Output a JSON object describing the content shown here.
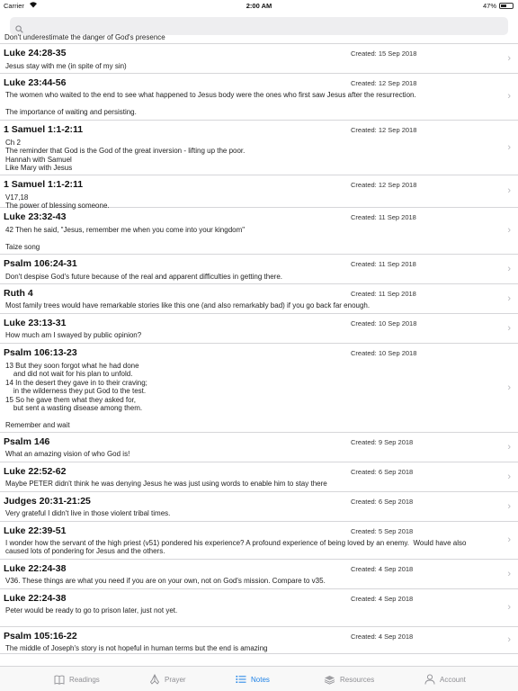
{
  "status": {
    "carrier": "Carrier",
    "time": "2:00 AM",
    "battery": "47%",
    "battery_level": 0.47
  },
  "search": {
    "placeholder": ""
  },
  "clipped_text": "Don't underestimate the danger of God's presence",
  "notes": [
    {
      "title": "Luke 24:28-35",
      "created": "Created: 15 Sep 2018",
      "body": "Jesus stay with me (in spite of my sin)"
    },
    {
      "title": "Luke 23:44-56",
      "created": "Created: 12 Sep 2018",
      "body": "The women who waited to the end to see what happened to Jesus body were the ones who first saw Jesus after the resurrection.\n\nThe importance of waiting and persisting."
    },
    {
      "title": "1 Samuel 1:1-2:11",
      "created": "Created: 12 Sep 2018",
      "body": "Ch 2\nThe reminder that God is the God of the great inversion - lifting up the poor.\nHannah with Samuel\nLike Mary with Jesus"
    },
    {
      "title": "1 Samuel 1:1-2:11",
      "created": "Created: 12 Sep 2018",
      "body": "V17,18\nThe power of blessing someone."
    },
    {
      "title": "Luke 23:32-43",
      "created": "Created: 11 Sep 2018",
      "body": "42 Then he said, \"Jesus, remember me when you come into your kingdom\"\n\nTaize song"
    },
    {
      "title": "Psalm 106:24-31",
      "created": "Created: 11 Sep 2018",
      "body": "Don't despise God's future because of the real and apparent difficulties in getting there."
    },
    {
      "title": "Ruth 4",
      "created": "Created: 11 Sep 2018",
      "body": "Most family trees would have remarkable stories like this one (and also remarkably bad) if you go back far enough."
    },
    {
      "title": "Luke 23:13-31",
      "created": "Created: 10 Sep 2018",
      "body": "How much am I swayed by public opinion?"
    },
    {
      "title": "Psalm 106:13-23",
      "created": "Created: 10 Sep 2018",
      "body": "13 But they soon forgot what he had done\n    and did not wait for his plan to unfold.\n14 In the desert they gave in to their craving;\n    in the wilderness they put God to the test.\n15 So he gave them what they asked for,\n    but sent a wasting disease among them.\n\nRemember and wait"
    },
    {
      "title": "Psalm 146",
      "created": "Created: 9 Sep 2018",
      "body": "What an amazing vision of who God is!"
    },
    {
      "title": "Luke 22:52-62",
      "created": "Created: 6 Sep 2018",
      "body": "Maybe PETER didn't think he was denying Jesus he was just using words to enable him to stay there"
    },
    {
      "title": "Judges 20:31-21:25",
      "created": "Created: 6 Sep 2018",
      "body": "Very grateful I didn't live in those violent tribal times."
    },
    {
      "title": "Luke 22:39-51",
      "created": "Created: 5 Sep 2018",
      "body": "I wonder how the servant of the high priest (v51) pondered his experience? A profound experience of being loved by an enemy.  Would have also\ncaused lots of pondering for Jesus and the others."
    },
    {
      "title": "Luke 22:24-38",
      "created": "Created: 4 Sep 2018",
      "body": "V36. These things are what you need if you are on your own, not on God's mission. Compare to v35."
    },
    {
      "title": "Luke 22:24-38",
      "created": "Created: 4 Sep 2018",
      "body": "Peter would be ready to go to prison later, just not yet."
    },
    {
      "title": "Psalm 105:16-22",
      "created": "Created: 4 Sep 2018",
      "body": "The middle of Joseph's story is not hopeful in human terms but the end is amazing"
    }
  ],
  "tabs": [
    {
      "label": "Readings",
      "icon": "book-icon",
      "active": false
    },
    {
      "label": "Prayer",
      "icon": "praying-hands-icon",
      "active": false
    },
    {
      "label": "Notes",
      "icon": "list-icon",
      "active": true
    },
    {
      "label": "Resources",
      "icon": "stack-icon",
      "active": false
    },
    {
      "label": "Account",
      "icon": "person-icon",
      "active": false
    }
  ],
  "colors": {
    "accent": "#1e82e6",
    "inactive": "#8e8e93",
    "separator": "#d6d6d9"
  }
}
